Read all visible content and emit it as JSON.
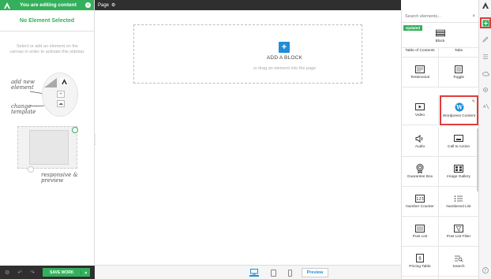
{
  "header": {
    "editing_label": "You are editing content",
    "page_label": "Page"
  },
  "left_sidebar": {
    "title": "No Element Selected",
    "hint": "Select or add an element on the canvas in order to activate this sidebar.",
    "annotations": {
      "add_new_element": "add new element",
      "change_template": "change template",
      "responsive_preview": "responsive & preview"
    },
    "save_button": "SAVE WORK"
  },
  "canvas": {
    "add_block_label": "ADD A BLOCK",
    "drag_hint": "or drag an element into the page"
  },
  "bottom_bar": {
    "preview_label": "Preview"
  },
  "elements_panel": {
    "search_placeholder": "Search elements...",
    "updated_badge": "Updated",
    "items": [
      {
        "label": "Block",
        "icon": "block-icon"
      },
      {
        "label": "Table of Contents",
        "icon": "table-of-contents-icon"
      },
      {
        "label": "Tabs",
        "icon": "tabs-icon"
      },
      {
        "label": "Testimonial",
        "icon": "testimonial-icon"
      },
      {
        "label": "Toggle",
        "icon": "toggle-icon"
      },
      {
        "label": "Video",
        "icon": "video-icon"
      },
      {
        "label": "Wordpress Content",
        "icon": "wordpress-icon"
      },
      {
        "label": "Audio",
        "icon": "audio-icon"
      },
      {
        "label": "Call to Action",
        "icon": "call-to-action-icon"
      },
      {
        "label": "Guarantee Box",
        "icon": "guarantee-box-icon"
      },
      {
        "label": "Image Gallery",
        "icon": "image-gallery-icon"
      },
      {
        "label": "Number Counter",
        "icon": "number-counter-icon"
      },
      {
        "label": "Numbered List",
        "icon": "numbered-list-icon"
      },
      {
        "label": "Post List",
        "icon": "post-list-icon"
      },
      {
        "label": "Post List Filter",
        "icon": "post-list-filter-icon"
      },
      {
        "label": "Pricing Table",
        "icon": "pricing-table-icon"
      },
      {
        "label": "Search",
        "icon": "search-icon"
      }
    ]
  },
  "colors": {
    "brand_green": "#34b05c",
    "accent_blue": "#1e8ed8",
    "highlight_red": "#e23c3c",
    "dark_bar": "#2f2f2f"
  }
}
